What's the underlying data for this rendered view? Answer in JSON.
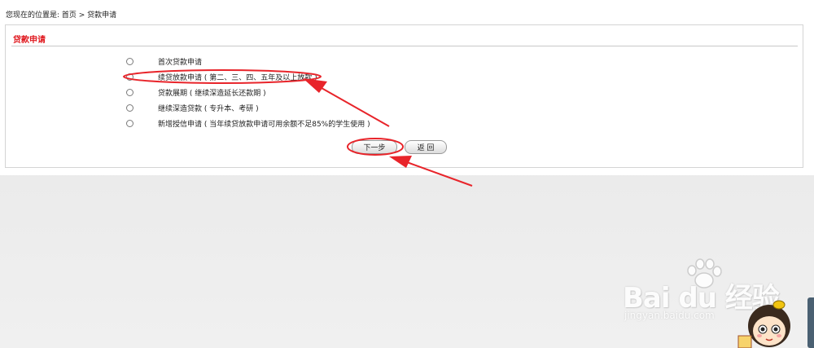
{
  "breadcrumb": "您现在的位置是: 首页 > 贷款申请",
  "panel": {
    "title": "贷款申请"
  },
  "options": [
    {
      "label": "首次贷款申请"
    },
    {
      "label": "续贷放款申请 ( 第二、三、四、五年及以上放款 )"
    },
    {
      "label": "贷款展期 ( 继续深造延长还款期 )"
    },
    {
      "label": "继续深造贷款 ( 专升本、考研 )"
    },
    {
      "label": "新增授信申请 ( 当年续贷放款申请可用余额不足85%的学生使用 )"
    }
  ],
  "buttons": {
    "next": "下一步",
    "back": "返 回"
  },
  "watermark": {
    "logo": "Bai du 经验",
    "url": "jingyan.baidu.com"
  },
  "colors": {
    "title_red": "#e0181e",
    "annotation_red": "#e8242a"
  }
}
